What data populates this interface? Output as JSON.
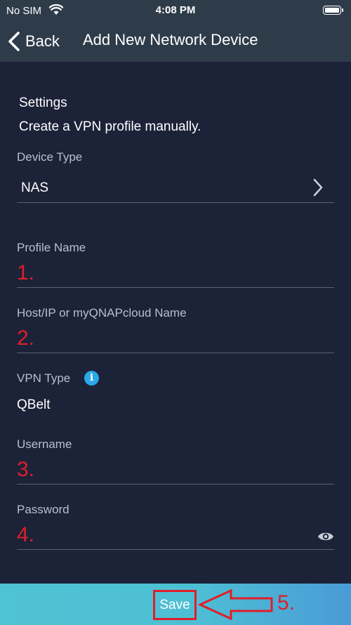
{
  "status_bar": {
    "carrier": "No SIM",
    "time": "4:08 PM"
  },
  "nav": {
    "back_label": "Back",
    "title": "Add New Network Device"
  },
  "section": {
    "title": "Settings",
    "subtitle": "Create a VPN profile manually."
  },
  "fields": {
    "device_type": {
      "label": "Device Type",
      "value": "NAS"
    },
    "profile_name": {
      "label": "Profile Name",
      "annotation": "1."
    },
    "host": {
      "label": "Host/IP or myQNAPcloud Name",
      "annotation": "2."
    },
    "vpn_type": {
      "label": "VPN Type",
      "value": "QBelt"
    },
    "username": {
      "label": "Username",
      "annotation": "3."
    },
    "password": {
      "label": "Password",
      "annotation": "4."
    }
  },
  "footer": {
    "save_label": "Save",
    "annotation": "5."
  },
  "icons": {
    "info": "i"
  },
  "colors": {
    "background": "#1c2238",
    "header": "#2e3c4a",
    "accent": "#2aa8e8",
    "annotation_red": "#e01e2a"
  }
}
